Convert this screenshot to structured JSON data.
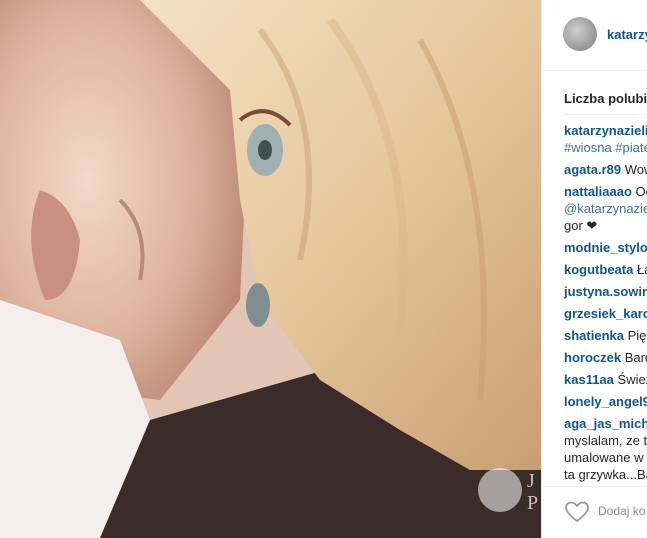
{
  "post": {
    "username": "katarzy",
    "likes_label": "Liczba polubie",
    "caption": {
      "user": "katarzynazielir",
      "tags": "#wiosna #piate"
    },
    "comments": [
      {
        "user": "agata.r89",
        "text": "Wow"
      },
      {
        "user": "nattaliaaao",
        "text": "Oc",
        "extra1": "@katarzynazie",
        "extra2": "gor ❤"
      },
      {
        "user": "modnie_stylow",
        "text": ""
      },
      {
        "user": "kogutbeata",
        "text": "Ła"
      },
      {
        "user": "justyna.sowins",
        "text": ""
      },
      {
        "user": "grzesiek_karo",
        "text": ""
      },
      {
        "user": "shatienka",
        "text": "Pięk"
      },
      {
        "user": "horoczek",
        "text": "Bard"
      },
      {
        "user": "kas11aa",
        "text": "Świeżo"
      },
      {
        "user": "lonely_angel9",
        "text": ""
      },
      {
        "user": "aga_jas_micha",
        "text": "",
        "extra1": "myslalam, ze t",
        "extra2": "umalowane w",
        "extra3": "ta grzywka...Ba"
      }
    ],
    "add_comment_placeholder": "Dodaj ko",
    "watermark": "J P"
  }
}
